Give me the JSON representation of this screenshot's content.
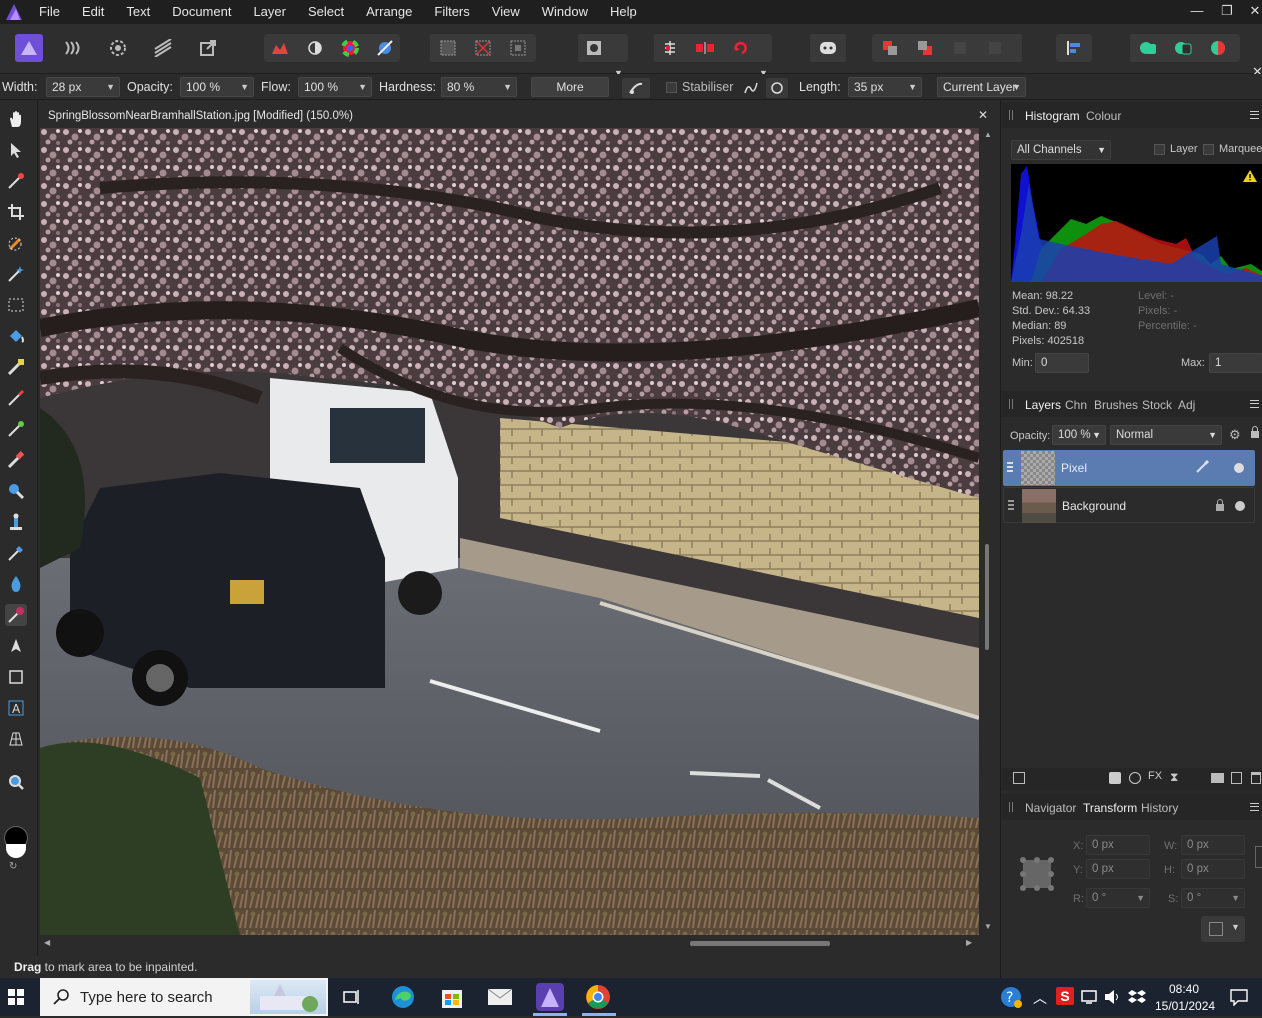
{
  "app": {
    "name": "Affinity Photo",
    "accent": "#6f4fd8"
  },
  "menu": {
    "items": [
      "File",
      "Edit",
      "Text",
      "Document",
      "Layer",
      "Select",
      "Arrange",
      "Filters",
      "View",
      "Window",
      "Help"
    ]
  },
  "window_controls": {
    "minimize": "—",
    "restore": "❐",
    "close": "✕"
  },
  "context_bar": {
    "width_label": "Width:",
    "width_value": "28 px",
    "opacity_label": "Opacity:",
    "opacity_value": "100 %",
    "flow_label": "Flow:",
    "flow_value": "100 %",
    "hardness_label": "Hardness:",
    "hardness_value": "80 %",
    "more_label": "More",
    "stabiliser_label": "Stabiliser",
    "length_label": "Length:",
    "length_value": "35 px",
    "layer_mode": "Current Layer"
  },
  "document": {
    "tab_title": "SpringBlossomNearBramhallStation.jpg [Modified] (150.0%)",
    "close": "✕"
  },
  "status": {
    "bold": "Drag",
    "text": " to mark area to be inpainted."
  },
  "histogram_panel": {
    "tabs": [
      "Histogram",
      "Colour"
    ],
    "channel": "All Channels",
    "layer_label": "Layer",
    "marquee_label": "Marquee",
    "stats_left": [
      "Mean: 98.22",
      "Std. Dev.: 64.33",
      "Median: 89",
      "Pixels: 402518"
    ],
    "stats_right": [
      "Level: -",
      "Pixels: -",
      "Percentile: -"
    ],
    "min_label": "Min:",
    "min_value": "0",
    "max_label": "Max:",
    "max_value": "1"
  },
  "layers_panel": {
    "tabs": [
      "Layers",
      "Chn",
      "Brushes",
      "Stock",
      "Adj"
    ],
    "opacity_label": "Opacity:",
    "opacity_value": "100 %",
    "blend_mode": "Normal",
    "layers": [
      {
        "name": "Pixel",
        "selected": true
      },
      {
        "name": "Background",
        "selected": false,
        "locked": true
      }
    ]
  },
  "transform_panel": {
    "tabs": [
      "Navigator",
      "Transform",
      "History"
    ],
    "x_label": "X:",
    "x_value": "0 px",
    "y_label": "Y:",
    "y_value": "0 px",
    "w_label": "W:",
    "w_value": "0 px",
    "h_label": "H:",
    "h_value": "0 px",
    "r_label": "R:",
    "r_value": "0 °",
    "s_label": "S:",
    "s_value": "0 °"
  },
  "taskbar": {
    "search_placeholder": "Type here to search",
    "time": "08:40",
    "date": "15/01/2024"
  }
}
